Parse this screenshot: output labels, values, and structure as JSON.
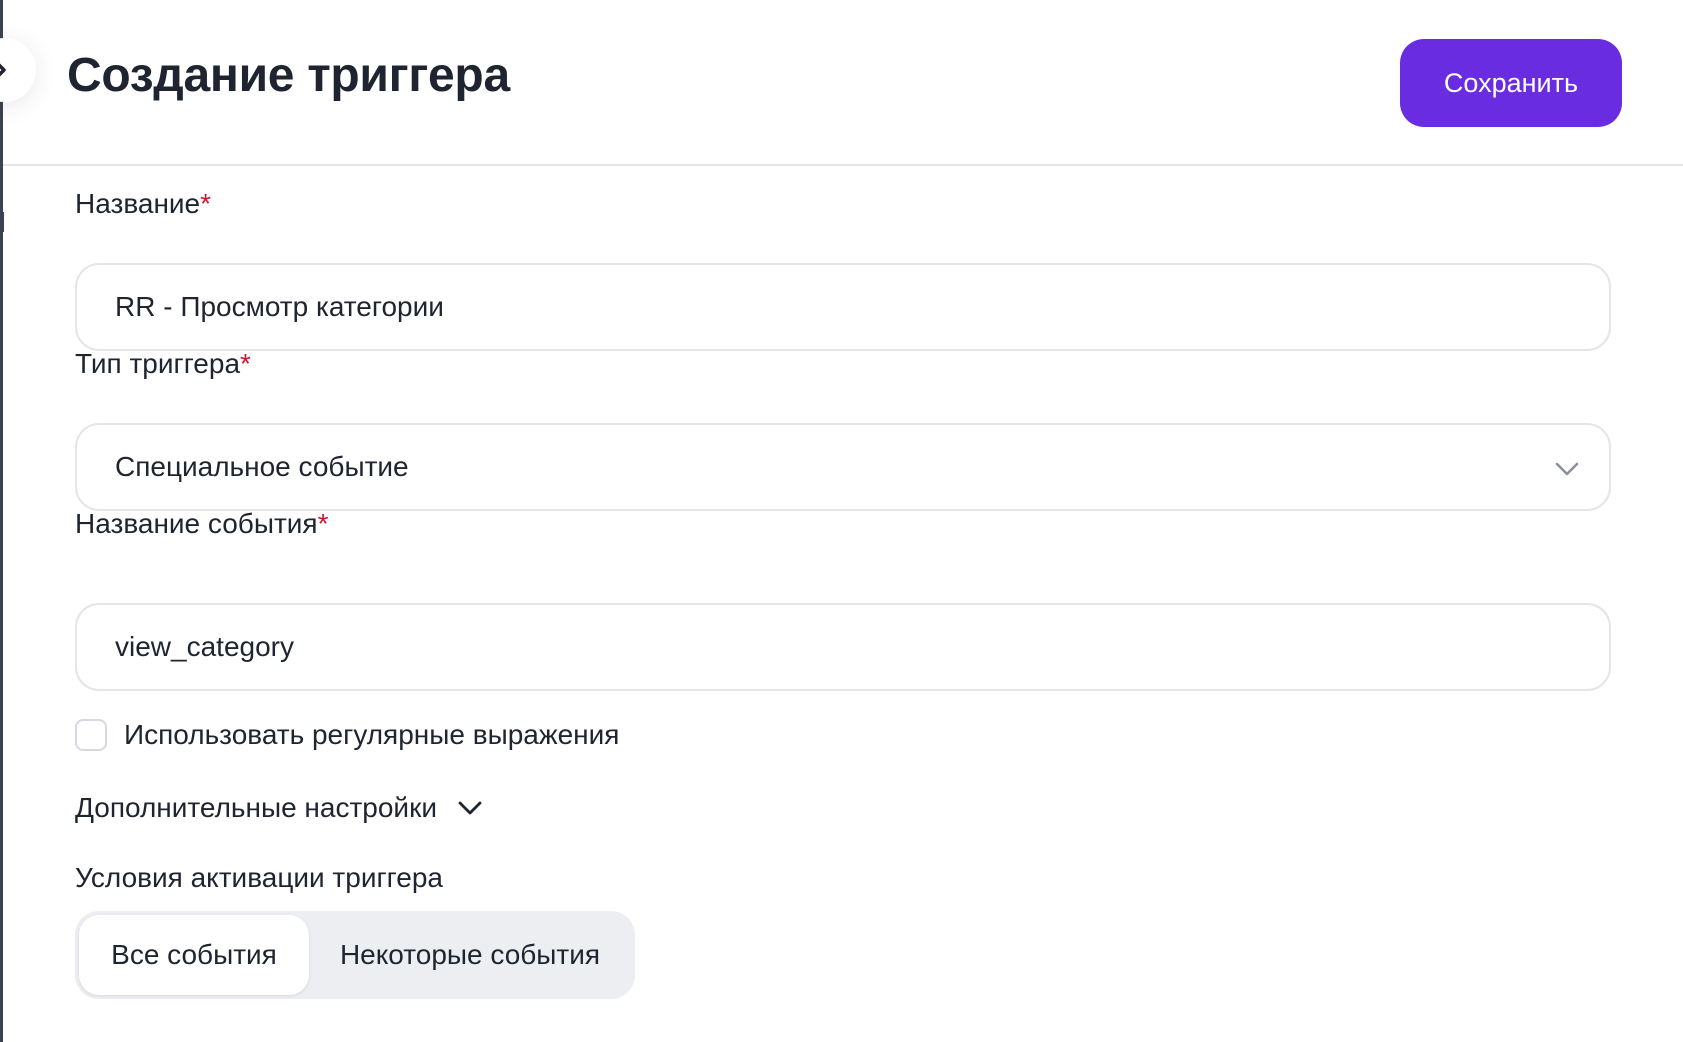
{
  "header": {
    "title": "Создание триггера",
    "save_label": "Сохранить"
  },
  "form": {
    "name": {
      "label": "Название",
      "required_mark": "*",
      "value": "RR - Просмотр категории"
    },
    "trigger_type": {
      "label": "Тип триггера",
      "required_mark": "*",
      "selected": "Специальное событие"
    },
    "event_name": {
      "label": "Название события",
      "required_mark": "*",
      "value": "view_category"
    },
    "use_regex": {
      "label": "Использовать регулярные выражения",
      "checked": false
    },
    "advanced": {
      "label": "Дополнительные настройки"
    },
    "activation": {
      "label": "Условия активации триггера",
      "options": [
        "Все события",
        "Некоторые события"
      ],
      "selected": "Все события"
    }
  },
  "colors": {
    "accent": "#6a2ce0",
    "required": "#d0162c",
    "border": "#e3e5ea",
    "segment_bg": "#eceef2"
  },
  "icons": {
    "sidebar_toggle": "chevron-right-icon",
    "select_chevron": "chevron-down-icon",
    "advanced_chevron": "chevron-down-icon"
  }
}
